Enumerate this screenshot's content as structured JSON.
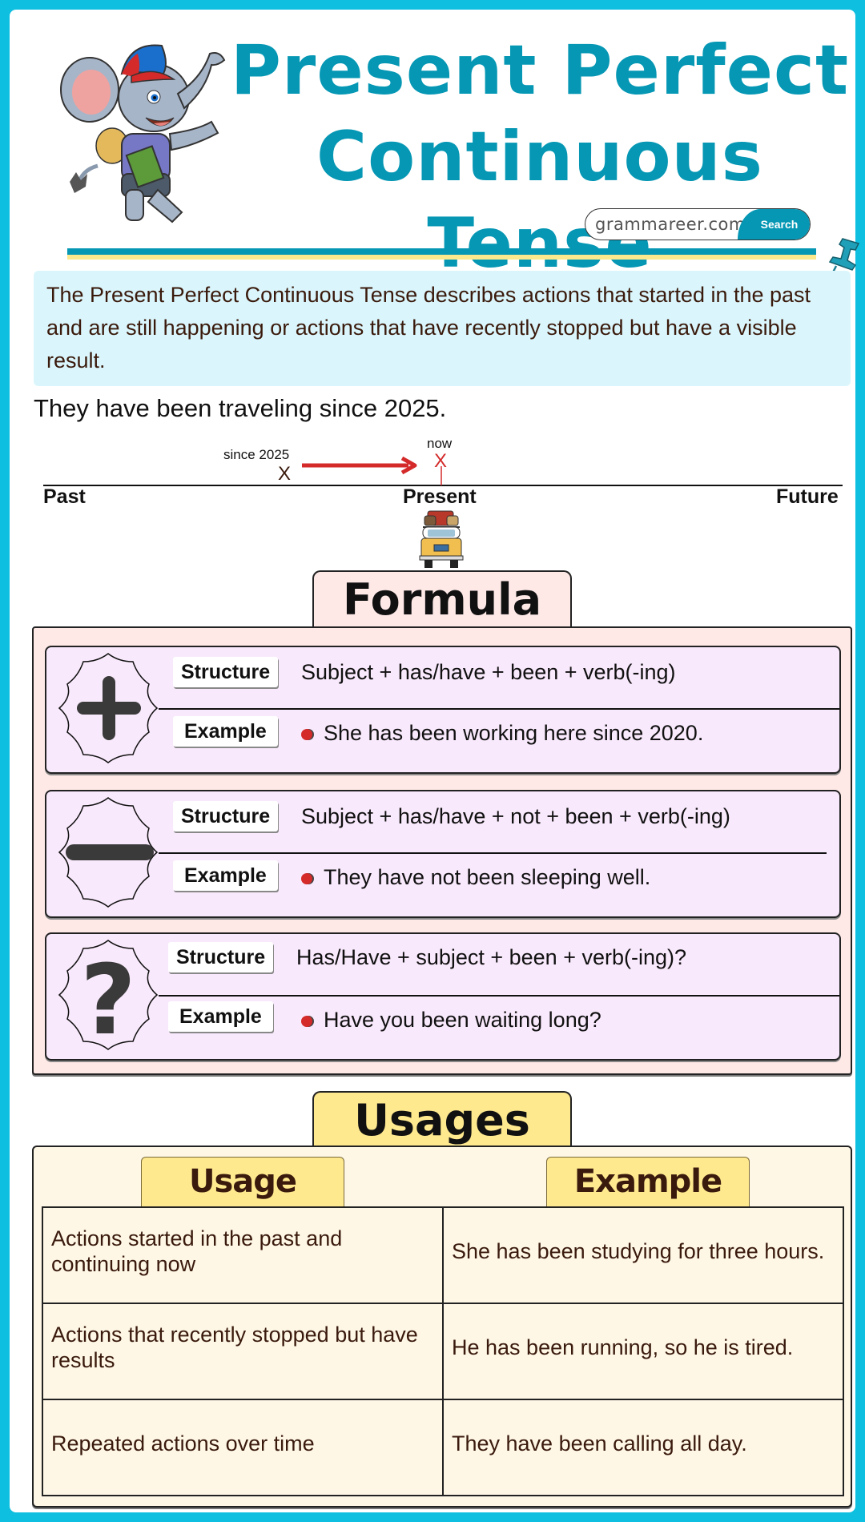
{
  "header": {
    "title_line1": "Present Perfect",
    "title_line2": "Continuous Tense",
    "search_text": "grammareer.com",
    "search_button": "Search"
  },
  "intro": {
    "definition": "The Present Perfect Continuous Tense describes actions that started in the past and are still happening or actions that have recently stopped but have a visible result."
  },
  "timeline": {
    "sentence": "They have been traveling since 2025.",
    "since_label": "since 2025",
    "now_label": "now",
    "marker": "X",
    "past": "Past",
    "present": "Present",
    "future": "Future"
  },
  "formula": {
    "title": "Formula",
    "structure_label": "Structure",
    "example_label": "Example",
    "rows": [
      {
        "type": "affirmative",
        "icon": "plus-icon",
        "structure": "Subject + has/have + been + verb(-ing)",
        "example": "She has been working here since 2020."
      },
      {
        "type": "negative",
        "icon": "minus-icon",
        "structure": "Subject + has/have + not + been + verb(-ing)",
        "example": "They have not been sleeping well."
      },
      {
        "type": "interrogative",
        "icon": "question-icon",
        "structure": "Has/Have + subject + been + verb(-ing)?",
        "example": "Have you been waiting long?"
      }
    ]
  },
  "usages": {
    "title": "Usages",
    "col_usage": "Usage",
    "col_example": "Example",
    "rows": [
      {
        "usage": "Actions started in the past and continuing now",
        "example": "She has been studying for three hours."
      },
      {
        "usage": "Actions that recently stopped but have results",
        "example": "He has been running, so he is tired."
      },
      {
        "usage": "Repeated actions over time",
        "example": "They have been calling all day."
      }
    ]
  },
  "colors": {
    "frame": "#0ebfdf",
    "title": "#0597b4",
    "intro_bg": "#daf6fc",
    "formula_bg": "#fee9e7",
    "card_bg": "#f9e9fc",
    "usages_tab": "#ffe98f",
    "usages_bg": "#fef7e6",
    "arrow_red": "#d42a2a"
  }
}
